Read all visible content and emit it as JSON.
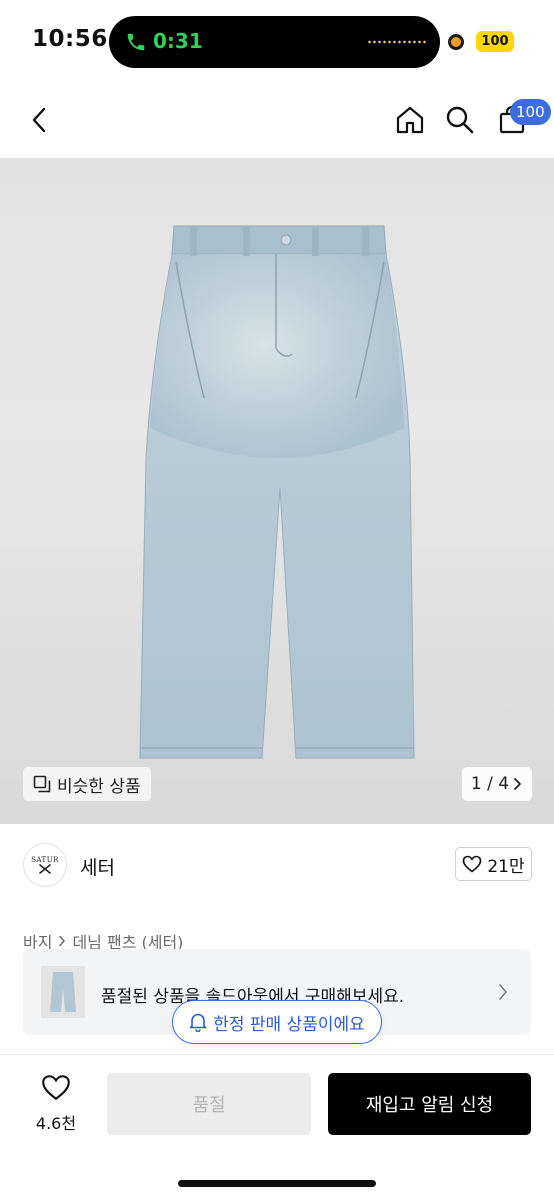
{
  "status_bar": {
    "time": "10:56",
    "call_duration": "0:31",
    "battery": "100"
  },
  "nav": {
    "cart_count": "100",
    "icons": [
      "chevron-left-icon",
      "home-icon",
      "search-icon",
      "bag-icon"
    ]
  },
  "gallery": {
    "similar_label": "비슷한 상품",
    "page_indicator": "1 / 4"
  },
  "brand": {
    "logo_text": "SATUR",
    "name": "세터",
    "like_count": "21만"
  },
  "breadcrumb": {
    "category": "바지",
    "subcategory": "데님 팬츠 (세터)"
  },
  "soldout_banner": {
    "text": "품절된 상품을 솔드아웃에서 구매해보세요."
  },
  "limited_pill": {
    "text": "한정 판매 상품이에요"
  },
  "bottom_bar": {
    "wish_count": "4.6천",
    "soldout_label": "품절",
    "restock_label": "재입고 알림 신청"
  },
  "colors": {
    "accent_blue": "#3c6ce0",
    "call_green": "#31d158",
    "battery_yellow": "#ffd60a",
    "denim": "#b8cad6"
  }
}
